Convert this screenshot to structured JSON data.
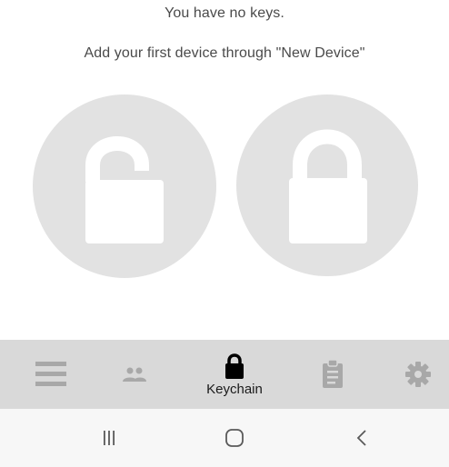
{
  "empty_state": {
    "title": "You have no keys.",
    "subtitle": "Add your first device through \"New Device\""
  },
  "illustration": {
    "left_icon": "unlocked-padlock-icon",
    "right_icon": "locked-padlock-icon"
  },
  "bottom_nav": {
    "items": [
      {
        "id": "menu",
        "icon": "hamburger-menu-icon",
        "label": ""
      },
      {
        "id": "people",
        "icon": "people-icon",
        "label": ""
      },
      {
        "id": "keychain",
        "icon": "padlock-icon",
        "label": "Keychain",
        "active": true
      },
      {
        "id": "clipboard",
        "icon": "clipboard-icon",
        "label": ""
      },
      {
        "id": "settings",
        "icon": "gear-icon",
        "label": ""
      }
    ]
  },
  "system_nav": {
    "recent_icon": "recent-apps-icon",
    "home_icon": "home-icon",
    "back_icon": "back-icon"
  },
  "colors": {
    "circle": "#e2e2e2",
    "lock_fill": "#ffffff",
    "nav_background": "#d9d9d9",
    "nav_inactive_icon": "#a8a8a8",
    "nav_active_icon": "#000000",
    "system_bar_background": "#f7f7f7",
    "text": "#4a4a4a"
  }
}
